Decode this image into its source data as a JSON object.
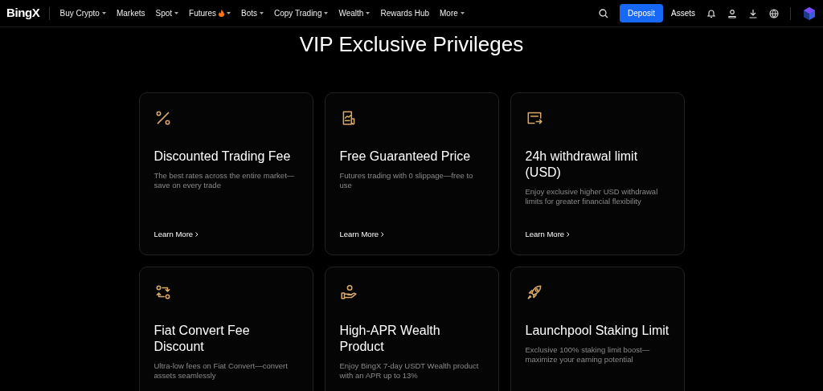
{
  "logo": "BingX",
  "nav": [
    {
      "label": "Buy Crypto",
      "dropdown": true,
      "hot": false
    },
    {
      "label": "Markets",
      "dropdown": false,
      "hot": false
    },
    {
      "label": "Spot",
      "dropdown": true,
      "hot": false
    },
    {
      "label": "Futures",
      "dropdown": true,
      "hot": true
    },
    {
      "label": "Bots",
      "dropdown": true,
      "hot": false
    },
    {
      "label": "Copy Trading",
      "dropdown": true,
      "hot": false
    },
    {
      "label": "Wealth",
      "dropdown": true,
      "hot": false
    },
    {
      "label": "Rewards Hub",
      "dropdown": false,
      "hot": false
    },
    {
      "label": "More",
      "dropdown": true,
      "hot": false
    }
  ],
  "deposit_button": "Deposit",
  "assets_link": "Assets",
  "heading": "VIP Exclusive Privileges",
  "cards": [
    {
      "kind": "percent",
      "title": "Discounted Trading Fee",
      "text": "The best rates across the entire market—save on every trade",
      "link": "Learn More"
    },
    {
      "kind": "chart",
      "title": "Free Guaranteed Price",
      "text": "Futures trading with 0 slippage—free to use",
      "link": "Learn More"
    },
    {
      "kind": "withdraw",
      "title": "24h withdrawal limit (USD)",
      "text": "Enjoy exclusive higher USD withdrawal limits for greater financial flexibility",
      "link": "Learn More"
    },
    {
      "kind": "convert",
      "title": "Fiat Convert Fee Discount",
      "text": "Ultra-low fees on Fiat Convert—convert assets seamlessly"
    },
    {
      "kind": "wealth",
      "title": "High-APR Wealth Product",
      "text": "Enjoy BingX 7-day USDT Wealth product with an APR up to 13%"
    },
    {
      "kind": "launchpool",
      "title": "Launchpool Staking Limit",
      "text": "Exclusive 100% staking limit boost—maximize your earning potential"
    }
  ]
}
